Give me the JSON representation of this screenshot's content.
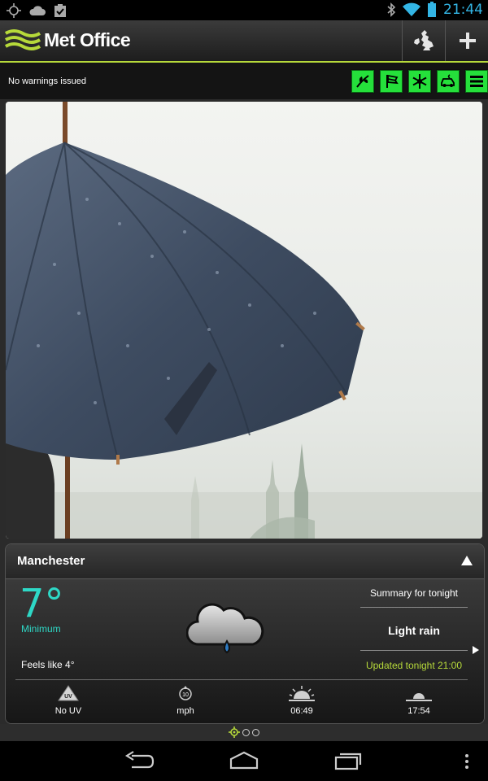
{
  "status_bar": {
    "time": "21:44",
    "left_icons": [
      "gps-icon",
      "cloud-icon",
      "clipboard-check-icon"
    ],
    "right_icons": [
      "bluetooth-icon",
      "wifi-icon",
      "battery-icon"
    ]
  },
  "header": {
    "app_title": "Met Office",
    "buttons": [
      "uk-map-icon",
      "add-icon"
    ]
  },
  "warnings": {
    "text": "No warnings issued",
    "quick_icons": [
      "pollen-icon",
      "beach-flag-icon",
      "snowflake-icon",
      "driving-icon",
      "menu-icon"
    ]
  },
  "forecast": {
    "location": "Manchester",
    "temperature": "7°",
    "temperature_label": "Minimum",
    "feels_like": "Feels like 4°",
    "summary_heading": "Summary for tonight",
    "summary": "Light rain",
    "updated": "Updated tonight 21:00",
    "weather_icon": "cloud-rain-icon",
    "stats": [
      {
        "icon": "uv-icon",
        "label": "No UV"
      },
      {
        "icon": "wind-icon",
        "badge": "10",
        "label": "mph"
      },
      {
        "icon": "sunrise-icon",
        "label": "06:49"
      },
      {
        "icon": "sunset-icon",
        "label": "17:54"
      }
    ]
  },
  "pager": {
    "pages": 3,
    "current": 0
  },
  "colors": {
    "accent_green": "#b6d93a",
    "temp_teal": "#2ed8c6",
    "icon_green": "#25e03b",
    "clock_blue": "#33b5e5"
  }
}
